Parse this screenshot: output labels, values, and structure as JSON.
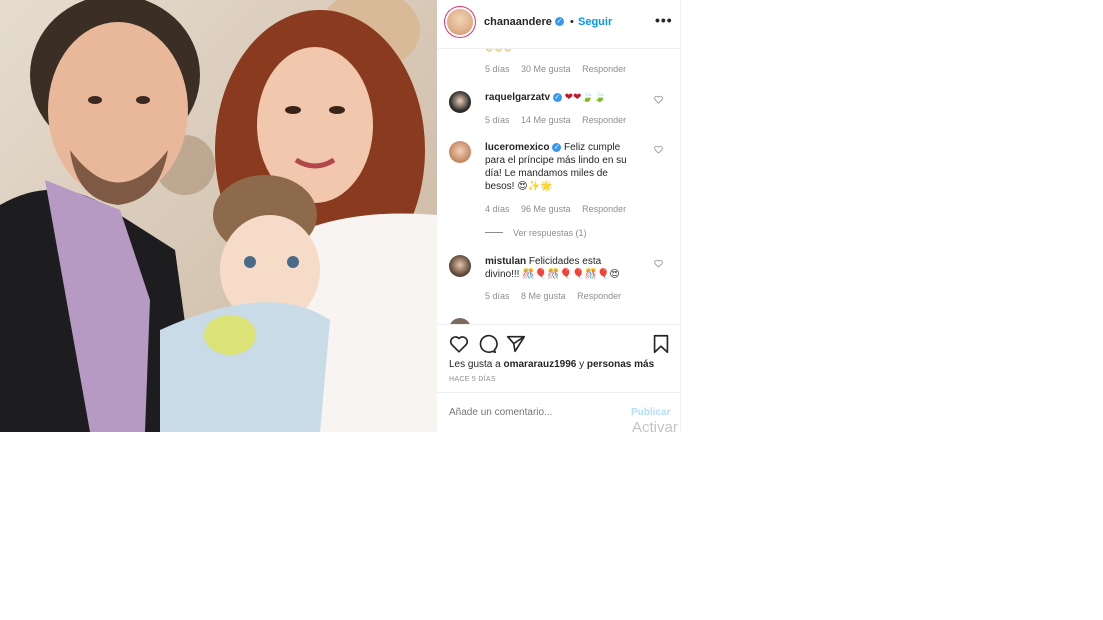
{
  "header": {
    "username": "chanaandere",
    "separator": "•",
    "follow_label": "Seguir",
    "more_label": "•••"
  },
  "top_partial": {
    "emoji": "😍😍😍",
    "age": "5 días",
    "likes": "30 Me gusta",
    "reply": "Responder"
  },
  "comments": [
    {
      "user": "raquelgarzatv",
      "text": "❤❤🍃🍃",
      "age": "5 días",
      "likes": "14 Me gusta",
      "reply": "Responder"
    },
    {
      "user": "luceromexico",
      "text": "Feliz cumple para el príncipe más lindo en su día! Le mandamos miles de besos! 😍✨🌟",
      "age": "4 días",
      "likes": "96 Me gusta",
      "reply": "Responder",
      "view_replies": "Ver respuestas (1)"
    },
    {
      "user": "mistulan",
      "text": "Felicidades esta divino!!! 🎊🎈🎊🎈🎈🎊🎈😍",
      "age": "5 días",
      "likes": "8 Me gusta",
      "reply": "Responder"
    }
  ],
  "actions": {
    "like_icon": "heart-icon",
    "comment_icon": "comment-icon",
    "share_icon": "paper-plane-icon",
    "save_icon": "bookmark-icon"
  },
  "likes": {
    "prefix": "Les gusta a",
    "user": "omararauz1996",
    "middle": "y",
    "others": "personas más"
  },
  "time_ago": "HACE 5 DÍAS",
  "add_comment": {
    "placeholder": "Añade un comentario...",
    "publish_label": "Publicar"
  },
  "watermark": "Activar",
  "colors": {
    "accent": "#0095f6",
    "verified": "#3897f0",
    "muted": "#8e8e8e",
    "border": "#efefef"
  }
}
